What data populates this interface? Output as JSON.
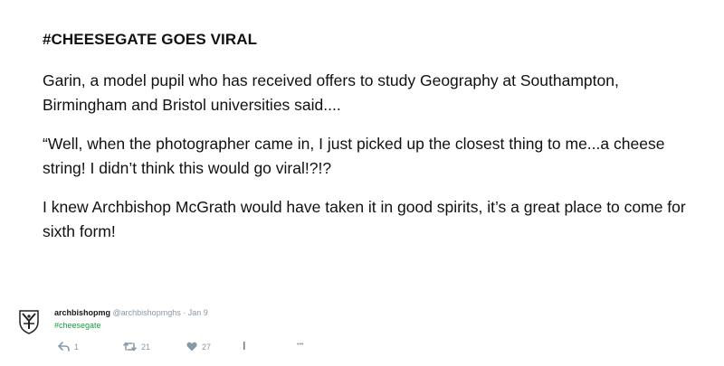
{
  "article": {
    "headline": "#CHEESEGATE GOES VIRAL",
    "paragraphs": [
      "Garin, a model pupil who has received offers to study Geography at Southampton, Birmingham and Bristol universities said....",
      "“Well, when the photographer came in, I just picked up the closest thing to me...a cheese string!  I didn’t think this would go viral!?!?",
      "I knew Archbishop McGrath would have taken it in good spirits, it’s a great place to come for sixth form!"
    ]
  },
  "tweet": {
    "username": "archbishopmg",
    "handle": "@archbishopmghs",
    "separator": "·",
    "date": "Jan 9",
    "hashtag": "#cheesegate",
    "avatar_icon": "school-crest-icon",
    "actions": {
      "reply_count": "1",
      "retweet_count": "21",
      "like_count": "27",
      "cursor_glyph": "I",
      "more_glyph": "•••"
    },
    "colors": {
      "hashtag": "#1a9c45",
      "meta": "#8899a6",
      "username": "#14171a"
    }
  }
}
